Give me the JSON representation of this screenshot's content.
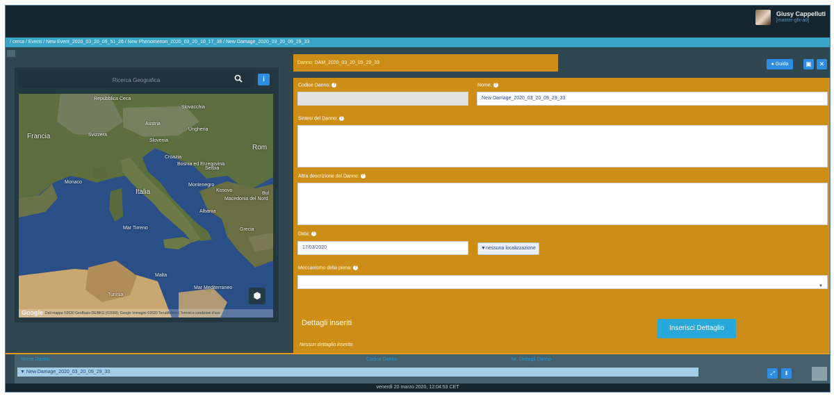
{
  "user": {
    "name": "Giusy Cappelluti",
    "role": "[master-gfx-ad]"
  },
  "breadcrumb": "/ cerca  /  Eventi  /  New Event_2020_03_20_09_51_26  /  New Phenomenon_2020_03_20_10_17_38  /  New Damage_2020_03_20_09_29_33",
  "map": {
    "search_placeholder": "Ricerca Geografica",
    "info_label": "i",
    "labels": {
      "francia": "Francia",
      "svizzera": "Svizzera",
      "austria": "Austria",
      "ungheria": "Ungheria",
      "croazia": "Croazia",
      "bosnia": "Bosnia ed Erzegovina",
      "serbia": "Serbia",
      "slovenia": "Slovenia",
      "monaco": "Monaco",
      "italia": "Italia",
      "montenegro": "Montenegro",
      "kosovo": "Kosovo",
      "macedonia": "Macedonia del Nord",
      "albania": "Albania",
      "mar_tirreno": "Mar Tirreno",
      "grecia": "Grecia",
      "malta": "Malta",
      "mar_mediterraneo": "Mar Mediterraneo",
      "tunisia": "Tunisia",
      "rom": "Rom",
      "bul": "Bul",
      "repubblica_ceca": "Repubblica Ceca",
      "slovacchia": "Slovacchia"
    },
    "google_logo": "Google",
    "footer": "Dati mappa ©2020 GeoBasis-DE/BKG (©2009), Google Immagini ©2020 TerraMetrics | Termini e condizioni d'uso"
  },
  "header": {
    "title_prefix": "Danno:",
    "title_value": " DAM_2020_03_20_09_29_33",
    "guide_label": "Guida"
  },
  "form": {
    "codice_label": "Codice Danno:",
    "codice_value": "",
    "nome_label": "Nome:",
    "nome_value": "New Damage_2020_03_20_09_29_33",
    "sintesi_label": "Sintesi del Danno:",
    "sintesi_value": "",
    "altra_label": "Altra descrizione del Danno:",
    "altra_value": "",
    "data_label": "Data:",
    "data_value": "17/03/2020",
    "loc_label": "nessuna localizzazione",
    "meccanismo_label": "Meccanismo della piena:",
    "meccanismo_value": ""
  },
  "details": {
    "title": "Dettagli inseriti",
    "insert_button": "Inserisci Dettaglio",
    "empty_text": "Nessun dettaglio inserito"
  },
  "table": {
    "headers": [
      "Nome Danno",
      "Codice Danno",
      "Nr. Dettagli Danno"
    ],
    "rows": [
      {
        "nome": "New Damage_2020_03_20_09_29_33"
      }
    ]
  },
  "status_bar": "venerdì 20 marzo 2020, 12:04:53 CET",
  "colors": {
    "accent": "#cc8e17",
    "button": "#2e8de0",
    "breadcrumb": "#3aa4c6",
    "topbar": "#16262f"
  },
  "icons": {
    "search": "search-icon",
    "info": "info-icon",
    "guide": "question-circle-icon",
    "save": "save-icon",
    "close": "close-icon",
    "location": "map-marker-icon",
    "expand": "expand-icon",
    "download": "download-icon",
    "layers": "layers-icon"
  }
}
